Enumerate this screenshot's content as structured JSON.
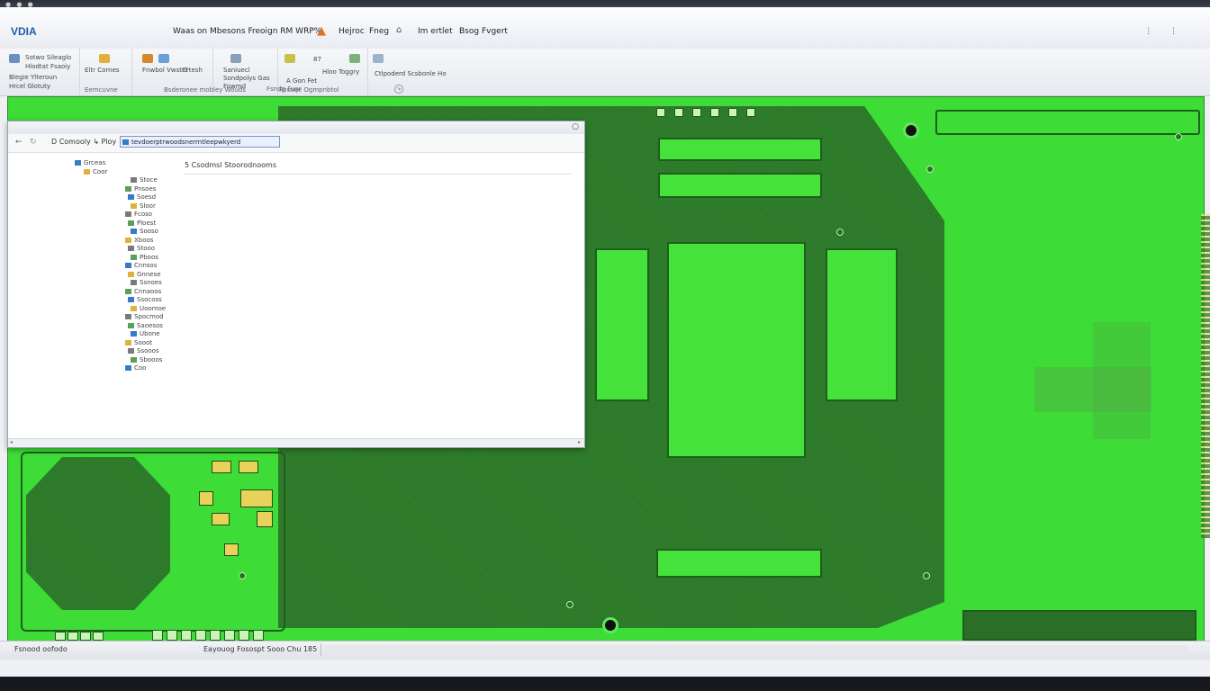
{
  "app": {
    "logo": "VDIA",
    "window_title": "Waas on Mbesons Freoign RM WRP%",
    "menu": [
      "Hejroc",
      "Fneg",
      "Im ertlet",
      "Bsog Fvgert"
    ],
    "window_controls": "⋮ ⋮"
  },
  "ribbon": {
    "groups": [
      {
        "buttons": [
          "Sotwo Sileaglo",
          "Hlodtat Fsaoiy",
          "Blegie Ylteroun",
          "Hrcel Glotuty"
        ],
        "label": ""
      },
      {
        "buttons": [
          "Eltr Cornes"
        ],
        "label": "Eemcuvne"
      },
      {
        "buttons": [
          "Fnwbol Vwstel",
          "Crtesh"
        ],
        "label": "Bsderonee mobley Wouds"
      },
      {
        "buttons": [
          "Saniuecl Sondpolys Gas Fowmd"
        ],
        "label": ""
      },
      {
        "buttons": [
          "87",
          "Hloo Toggry",
          "A Gon Fet"
        ],
        "label": "Fpsoqe Ogmpnbtol"
      },
      {
        "buttons": [
          "Ctlpoderd Scsbonle Ho"
        ],
        "label": ""
      }
    ],
    "group_footer": "Fsndp Fuor"
  },
  "explorer": {
    "back": "←",
    "forward": "↻",
    "breadcrumb": "D Comooly ↳ Ploy",
    "path": "tevdoerptrwoodsnerrntleepwkyerd",
    "close": "○",
    "content_header": "5 Csodmsl Stoorodnooms",
    "tree": [
      "Grceas",
      "Coor",
      "Stoce",
      "Pnsoes",
      "Soesd",
      "Sloor",
      "Fcoso",
      "Ploest",
      "Sooso",
      "Xboos",
      "Stooo",
      "Pboos",
      "Cnnsos",
      "Gnnese",
      "Ssnoes",
      "Cnnaoos",
      "Ssocoss",
      "Uoomoe",
      "Spocmod",
      "Saoesos",
      "Ubone",
      "Sooot",
      "Ssooos",
      "Sbooos",
      "Coo"
    ],
    "scroll_left": "◂",
    "scroll_right": "▸"
  },
  "status": {
    "left": "Fsnood oofodo",
    "middle": "Eayouog Fosospt Sooo Chu 185"
  },
  "colors": {
    "board": "#3ddc36",
    "copper_dark": "#2f7f2c",
    "trace": "#1f5e1d",
    "accent": "#1d5fa8"
  }
}
